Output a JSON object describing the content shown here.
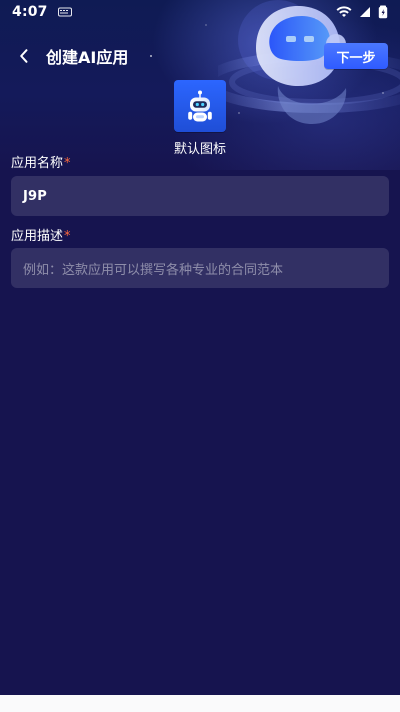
{
  "status_bar": {
    "time": "4:07"
  },
  "header": {
    "title": "创建AI应用",
    "next_label": "下一步"
  },
  "icon_section": {
    "label": "默认图标"
  },
  "form": {
    "app_name": {
      "label": "应用名称",
      "required_mark": "*",
      "value": "J9P"
    },
    "app_description": {
      "label": "应用描述",
      "required_mark": "*",
      "placeholder": "例如：这款应用可以撰写各种专业的合同范本"
    }
  },
  "theme": {
    "background": "#16144f",
    "accent": "#2f5bff",
    "required": "#ff6a3d"
  }
}
